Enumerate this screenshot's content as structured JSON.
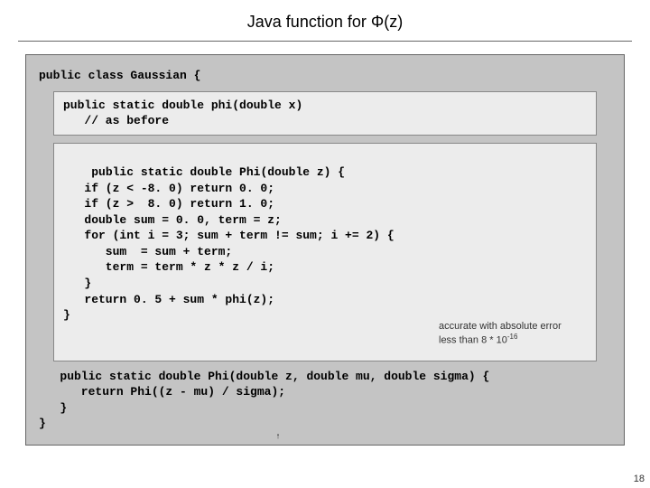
{
  "title": "Java function for Φ(z)",
  "class_open": "public class Gaussian {",
  "class_close": "}",
  "block1": "public static double phi(double x)\n   // as before",
  "block2": "public static double Phi(double z) {\n   if (z < -8. 0) return 0. 0;\n   if (z >  8. 0) return 1. 0;\n   double sum = 0. 0, term = z;\n   for (int i = 3; sum + term != sum; i += 2) {\n      sum  = sum + term;\n      term = term * z * z / i;\n   }\n   return 0. 5 + sum * phi(z);\n}",
  "annot_line1": "accurate with absolute error",
  "annot_line2_a": "less than 8 * 10",
  "annot_line2_sup": "-16",
  "block3": "   public static double Phi(double z, double mu, double sigma) {\n      return Phi((z - mu) / sigma);\n   }",
  "page_num": "18"
}
